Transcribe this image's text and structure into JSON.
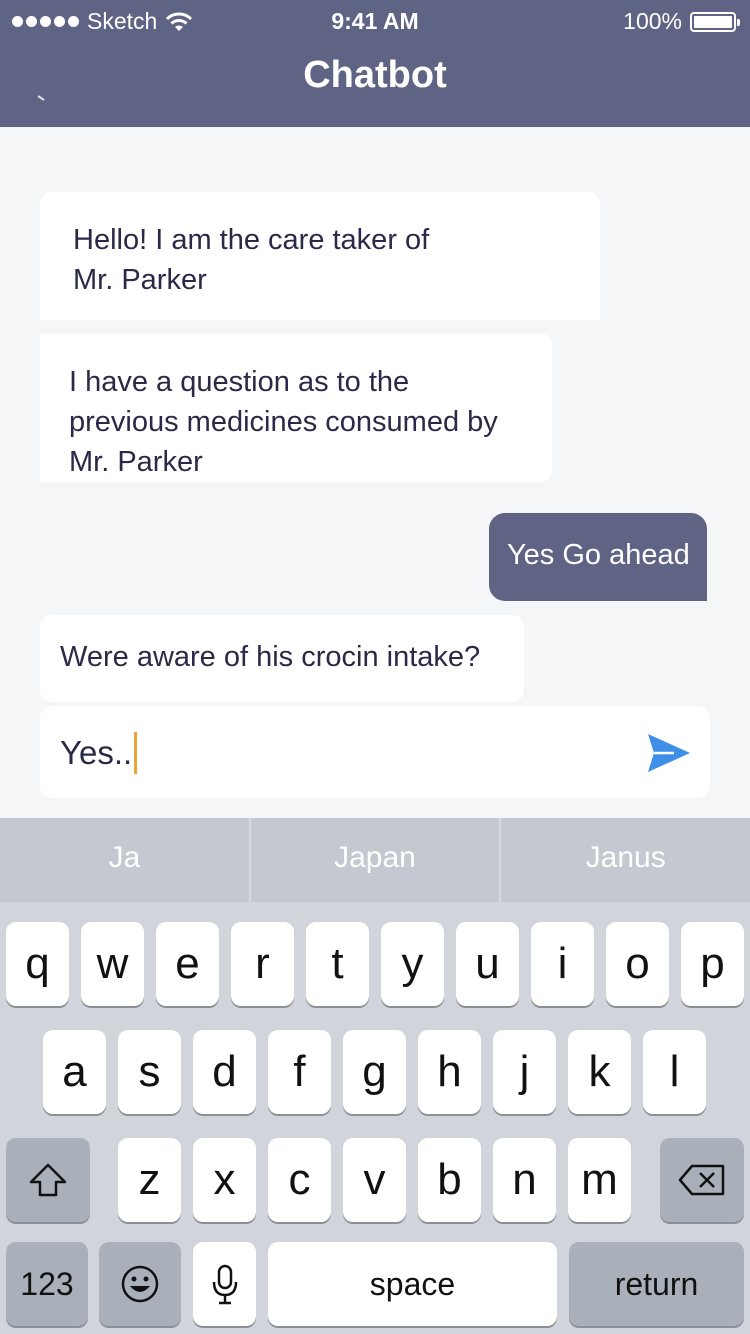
{
  "status_bar": {
    "carrier": "Sketch",
    "time": "9:41 AM",
    "battery": "100%"
  },
  "nav": {
    "title": "Chatbot"
  },
  "messages": [
    {
      "text": "Hello! I am the care taker of\nMr. Parker",
      "from": "bot"
    },
    {
      "text": "I have a question as to the\nprevious medicines consumed by\nMr. Parker",
      "from": "bot"
    },
    {
      "text": "Yes Go ahead",
      "from": "user"
    },
    {
      "text": "Were aware of his crocin intake?",
      "from": "bot"
    }
  ],
  "composer": {
    "value": "Yes..",
    "send_icon": "send-icon"
  },
  "suggestions": [
    "Ja",
    "Japan",
    "Janus"
  ],
  "keyboard": {
    "row1": [
      "q",
      "w",
      "e",
      "r",
      "t",
      "y",
      "u",
      "i",
      "o",
      "p"
    ],
    "row2": [
      "a",
      "s",
      "d",
      "f",
      "g",
      "h",
      "j",
      "k",
      "l"
    ],
    "row3": [
      "z",
      "x",
      "c",
      "v",
      "b",
      "n",
      "m"
    ],
    "numbers_label": "123",
    "space_label": "space",
    "return_label": "return"
  },
  "colors": {
    "header": "#5f6384",
    "user_bubble": "#5f6384",
    "background": "#f5f6f8",
    "send_icon": "#3d8fe8",
    "caret": "#f0a23a"
  }
}
